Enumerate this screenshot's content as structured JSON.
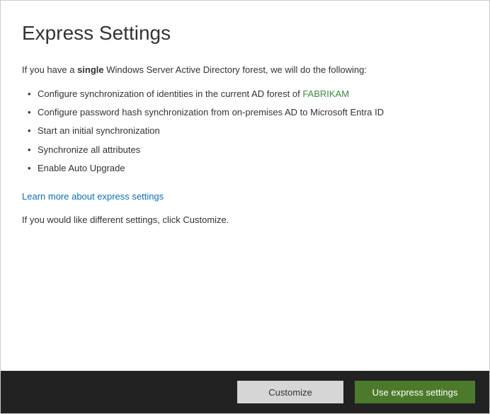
{
  "title": "Express Settings",
  "intro": {
    "prefix": "If you have a ",
    "bold": "single",
    "suffix": " Windows Server Active Directory forest, we will do the following:"
  },
  "bullets": [
    {
      "prefix": "Configure synchronization of identities in the current AD forest of ",
      "forest": "FABRIKAM"
    },
    {
      "text": "Configure password hash synchronization from on-premises AD to Microsoft Entra ID"
    },
    {
      "text": "Start an initial synchronization"
    },
    {
      "text": "Synchronize all attributes"
    },
    {
      "text": "Enable Auto Upgrade"
    }
  ],
  "learn_more": "Learn more about express settings",
  "customize_hint": "If you would like different settings, click Customize.",
  "buttons": {
    "customize": "Customize",
    "express": "Use express settings"
  }
}
